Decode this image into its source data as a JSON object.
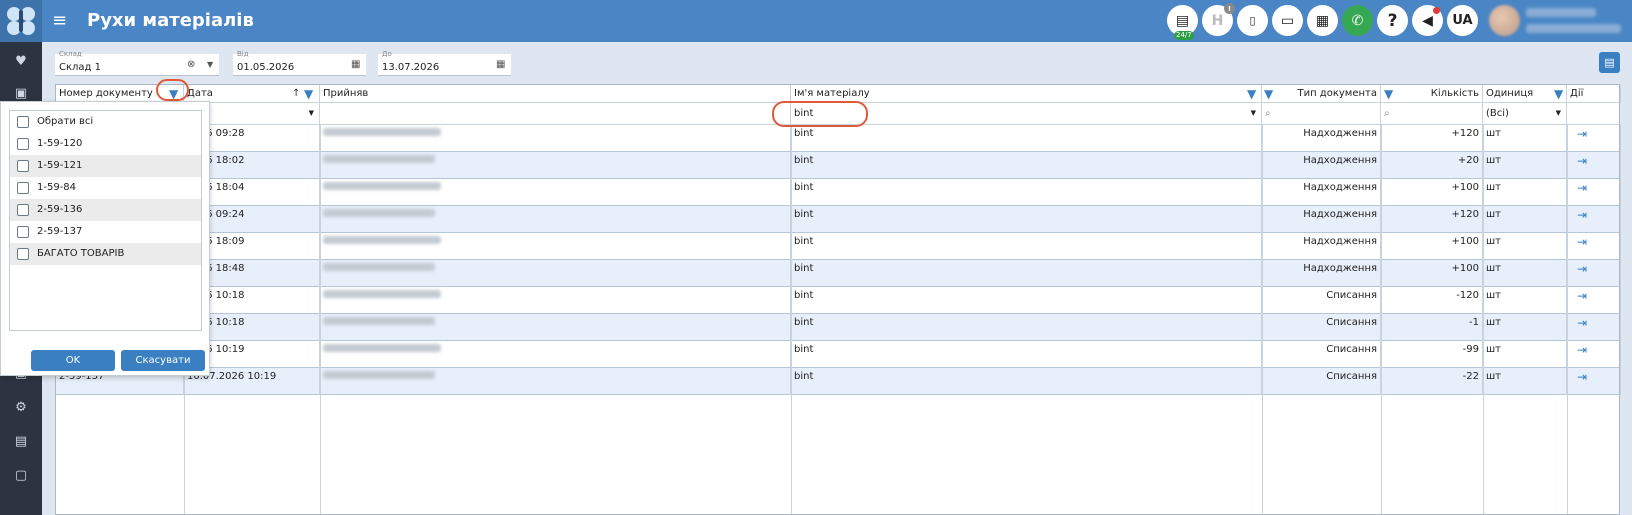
{
  "app": {
    "title": "Рухи матеріалів",
    "menu_icon": "hamburger-icon",
    "brand_color": "#4a86c5"
  },
  "header": {
    "badge_24_7": "24/7",
    "lang": "UA",
    "icons": [
      "chat-icon",
      "h-icon",
      "pdf-icon",
      "card-icon",
      "calculator-icon",
      "phone-icon",
      "help-icon",
      "megaphone-icon"
    ]
  },
  "filters": {
    "warehouse": {
      "label": "Склад",
      "value": "Склад 1"
    },
    "from": {
      "label": "Від",
      "value": "01.05.2026"
    },
    "to": {
      "label": "До",
      "value": "13.07.2026"
    }
  },
  "grid": {
    "columns": {
      "doc": "Номер документу",
      "date": "Дата",
      "received": "Прийняв",
      "material": "Ім'я матеріалу",
      "doctype": "Тип документа",
      "qty": "Кількість",
      "unit": "Одиниця",
      "actions": "Дії"
    },
    "filter_row": {
      "material_value": "bint",
      "unit_value": "(Всі)"
    },
    "rows": [
      {
        "doc": "",
        "date": "2026 09:28",
        "material": "bint",
        "type": "Надходження",
        "qty": "+120",
        "unit": "шт"
      },
      {
        "doc": "",
        "date": "2026 18:02",
        "material": "bint",
        "type": "Надходження",
        "qty": "+20",
        "unit": "шт"
      },
      {
        "doc": "",
        "date": "2026 18:04",
        "material": "bint",
        "type": "Надходження",
        "qty": "+100",
        "unit": "шт"
      },
      {
        "doc": "",
        "date": "2026 09:24",
        "material": "bint",
        "type": "Надходження",
        "qty": "+120",
        "unit": "шт"
      },
      {
        "doc": "",
        "date": "2026 18:09",
        "material": "bint",
        "type": "Надходження",
        "qty": "+100",
        "unit": "шт"
      },
      {
        "doc": "",
        "date": "2026 18:48",
        "material": "bint",
        "type": "Надходження",
        "qty": "+100",
        "unit": "шт"
      },
      {
        "doc": "",
        "date": "2026 10:18",
        "material": "bint",
        "type": "Списання",
        "qty": "-120",
        "unit": "шт"
      },
      {
        "doc": "",
        "date": "2026 10:18",
        "material": "bint",
        "type": "Списання",
        "qty": "-1",
        "unit": "шт"
      },
      {
        "doc": "",
        "date": "2026 10:19",
        "material": "bint",
        "type": "Списання",
        "qty": "-99",
        "unit": "шт"
      },
      {
        "doc": "2-59-137",
        "date": "10.07.2026 10:19",
        "material": "bint",
        "type": "Списання",
        "qty": "-22",
        "unit": "шт"
      }
    ]
  },
  "popup": {
    "items": [
      "Обрати всі",
      "1-59-120",
      "1-59-121",
      "1-59-84",
      "2-59-136",
      "2-59-137",
      "БАГАТО ТОВАРІВ"
    ],
    "ok": "OK",
    "cancel": "Скасувати"
  }
}
